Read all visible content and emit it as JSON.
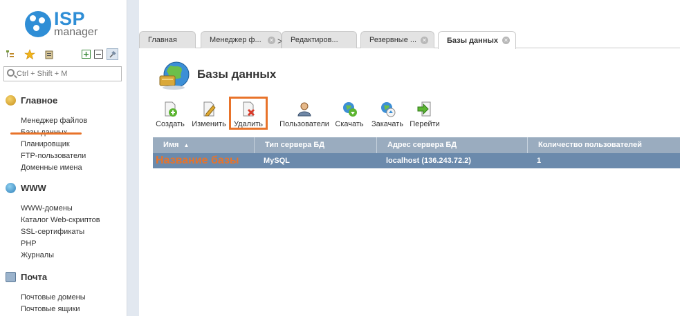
{
  "brand": {
    "logo_main": "ISP",
    "logo_sub": "manager",
    "color": "#2f8ed6"
  },
  "accent_highlight": "#e8732a",
  "sidebar": {
    "tools": [
      "tree-icon",
      "star-icon",
      "clipboard-icon",
      "expand-icon",
      "collapse-icon",
      "pin-icon"
    ],
    "search_placeholder": "Ctrl + Shift + M",
    "groups": [
      {
        "title": "Главное",
        "icon": "home-icon",
        "items": [
          "Менеджер файлов",
          "Базы данных",
          "Планировщик",
          "FTP-пользователи",
          "Доменные имена"
        ]
      },
      {
        "title": "WWW",
        "icon": "globe-icon",
        "items": [
          "WWW-домены",
          "Каталог Web-скриптов",
          "SSL-сертификаты",
          "PHP",
          "Журналы"
        ]
      },
      {
        "title": "Почта",
        "icon": "mail-icon",
        "items": [
          "Почтовые домены",
          "Почтовые ящики"
        ]
      }
    ]
  },
  "tabs": [
    {
      "label": "Главная",
      "closable": false
    },
    {
      "label": "Менеджер ф...",
      "closable": true
    },
    {
      "label": "Редактиров...",
      "closable": true
    },
    {
      "label": "Резервные ...",
      "closable": true
    },
    {
      "label": "Базы данных",
      "closable": true,
      "active": true
    }
  ],
  "tab_separator": ">",
  "page": {
    "title": "Базы данных"
  },
  "toolbar": [
    {
      "label": "Создать",
      "icon": "create-icon"
    },
    {
      "label": "Изменить",
      "icon": "edit-icon"
    },
    {
      "label": "Удалить",
      "icon": "delete-icon",
      "highlighted": true
    },
    {
      "label": "Пользователи",
      "icon": "users-icon"
    },
    {
      "label": "Скачать",
      "icon": "download-icon"
    },
    {
      "label": "Закачать",
      "icon": "upload-icon"
    },
    {
      "label": "Перейти",
      "icon": "goto-icon"
    }
  ],
  "grid": {
    "columns": [
      "Имя",
      "Тип сервера БД",
      "Адрес сервера БД",
      "Количество пользователей"
    ],
    "sort_indicator": "▲",
    "rows": [
      {
        "name": "Название базы",
        "type": "MySQL",
        "address": "localhost (136.243.72.2)",
        "users": "1",
        "selected": true
      }
    ]
  }
}
